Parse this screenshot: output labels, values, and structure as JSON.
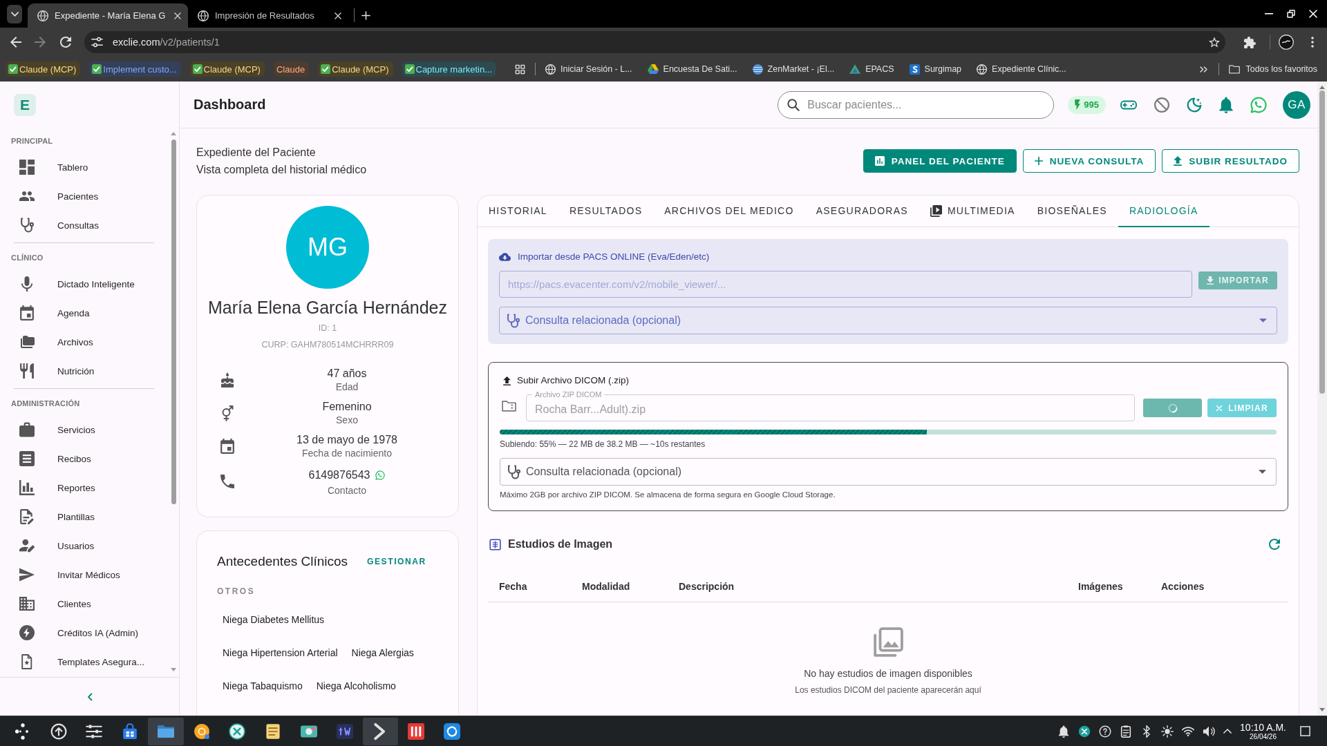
{
  "browser": {
    "tabs": [
      {
        "title": "Expediente - María Elena G",
        "selected": true
      },
      {
        "title": "Impresión de Resultados",
        "selected": false
      }
    ],
    "can_go_forward": false,
    "address": {
      "host": "exclie.com",
      "path": "/v2/patients/1"
    },
    "tab_groups": [
      {
        "label": "Claude (MCP)",
        "color": "#4a4128",
        "done": true
      },
      {
        "label": "Implement custo...",
        "color": "#34405a",
        "done": true
      },
      {
        "label": "Claude (MCP)",
        "color": "#4a4128",
        "done": true
      },
      {
        "label": "Claude",
        "color": "#4d3b30",
        "done": false
      },
      {
        "label": "Claude (MCP)",
        "color": "#4a4128",
        "done": true
      },
      {
        "label": "Capture marketin...",
        "color": "#2c4a4f",
        "done": true
      }
    ],
    "bookmarks": [
      {
        "label": "Iniciar Sesión - L..."
      },
      {
        "label": "Encuesta De Sati..."
      },
      {
        "label": "ZenMarket - ¡El..."
      },
      {
        "label": "EPACS"
      },
      {
        "label": "Surgimap"
      },
      {
        "label": "Expediente Clínic..."
      }
    ],
    "all_bookmarks": "Todos los favoritos"
  },
  "sidebar": {
    "logo": "E",
    "sections": [
      {
        "title": "PRINCIPAL",
        "items": [
          {
            "label": "Tablero",
            "selected": false
          },
          {
            "label": "Pacientes",
            "selected": false
          },
          {
            "label": "Consultas",
            "selected": false
          }
        ]
      },
      {
        "title": "CLÍNICO",
        "items": [
          {
            "label": "Dictado Inteligente",
            "selected": false
          },
          {
            "label": "Agenda",
            "selected": false
          },
          {
            "label": "Archivos",
            "selected": false
          },
          {
            "label": "Nutrición",
            "selected": false
          }
        ]
      },
      {
        "title": "ADMINISTRACIÓN",
        "items": [
          {
            "label": "Servicios",
            "selected": false
          },
          {
            "label": "Recibos",
            "selected": false
          },
          {
            "label": "Reportes",
            "selected": false
          },
          {
            "label": "Plantillas",
            "selected": false
          },
          {
            "label": "Usuarios",
            "selected": false
          },
          {
            "label": "Invitar Médicos",
            "selected": false
          },
          {
            "label": "Clientes",
            "selected": false
          },
          {
            "label": "Créditos IA (Admin)",
            "selected": false
          },
          {
            "label": "Templates Asegura...",
            "selected": false
          }
        ]
      }
    ]
  },
  "header": {
    "title": "Dashboard",
    "search_placeholder": "Buscar pacientes...",
    "credits": "995",
    "avatar": "GA"
  },
  "page": {
    "title": "Expediente del Paciente",
    "subtitle": "Vista completa del historial médico",
    "actions": [
      {
        "label": "PANEL DEL PACIENTE",
        "kind": "filled"
      },
      {
        "label": "NUEVA CONSULTA",
        "kind": "outlined"
      },
      {
        "label": "SUBIR RESULTADO",
        "kind": "outlined"
      }
    ]
  },
  "patient": {
    "initials": "MG",
    "name": "María Elena García Hernández",
    "id": "ID: 1",
    "curp": "CURP: GAHM780514MCHRRR09",
    "facts": [
      {
        "kind": "age",
        "value": "47 años",
        "label": "Edad"
      },
      {
        "kind": "sex",
        "value": "Femenino",
        "label": "Sexo"
      },
      {
        "kind": "birth",
        "value": "13 de mayo de 1978",
        "label": "Fecha de nacimiento"
      },
      {
        "kind": "phone",
        "value": "6149876543",
        "label": "Contacto"
      }
    ]
  },
  "history": {
    "title": "Antecedentes Clínicos",
    "action": "GESTIONAR",
    "group": "OTROS",
    "items": [
      "Niega Diabetes Mellitus",
      "Niega Hipertension Arterial",
      "Niega Alergias",
      "Niega Tabaquismo",
      "Niega Alcoholismo"
    ]
  },
  "record": {
    "tabs": [
      {
        "label": "HISTORIAL",
        "kind": "plain",
        "selected": false
      },
      {
        "label": "RESULTADOS",
        "kind": "plain",
        "selected": false
      },
      {
        "label": "ARCHIVOS DEL MEDICO",
        "kind": "plain",
        "selected": false
      },
      {
        "label": "ASEGURADORAS",
        "kind": "plain",
        "selected": false
      },
      {
        "label": "MULTIMEDIA",
        "kind": "icon",
        "selected": false
      },
      {
        "label": "BIOSEÑALES",
        "kind": "plain",
        "selected": false
      },
      {
        "label": "RADIOLOGÍA",
        "kind": "plain",
        "selected": true
      }
    ],
    "pacs": {
      "title": "Importar desde PACS ONLINE (Eva/Eden/etc)",
      "url_placeholder": "https://pacs.evacenter.com/v2/mobile_viewer/...",
      "import": {
        "label": "IMPORTAR",
        "disabled": true
      },
      "consult_placeholder": "Consulta relacionada (opcional)"
    },
    "upload": {
      "title": "Subir Archivo DICOM (.zip)",
      "file": {
        "label": "Archivo ZIP DICOM",
        "value": "Rocha Barr...Adult).zip",
        "disabled": true
      },
      "submit": {
        "loading": true
      },
      "clear": {
        "label": "LIMPIAR"
      },
      "progress": {
        "level": 0.55,
        "text": "Subiendo: 55% — 22 MB de 38.2 MB — ~10s restantes"
      },
      "consult_placeholder": "Consulta relacionada (opcional)",
      "note": "Máximo 2GB por archivo ZIP DICOM. Se almacena de forma segura en Google Cloud Storage."
    },
    "studies": {
      "title": "Estudios de Imagen",
      "columns": [
        "Fecha",
        "Modalidad",
        "Descripción",
        "Imágenes",
        "Acciones"
      ],
      "empty_title": "No hay estudios de imagen disponibles",
      "empty_text": "Los estudios DICOM del paciente aparecerán aquí"
    }
  },
  "taskbar": {
    "apps": [
      {
        "active": false
      },
      {
        "active": false
      },
      {
        "active": false
      },
      {
        "active": false
      },
      {
        "active": true
      },
      {
        "active": false
      },
      {
        "active": false
      },
      {
        "active": false
      },
      {
        "active": false
      },
      {
        "active": false
      },
      {
        "active": true
      },
      {
        "active": false
      },
      {
        "active": false
      }
    ],
    "time": "10:10 A.M.",
    "date": "26/04/26"
  }
}
